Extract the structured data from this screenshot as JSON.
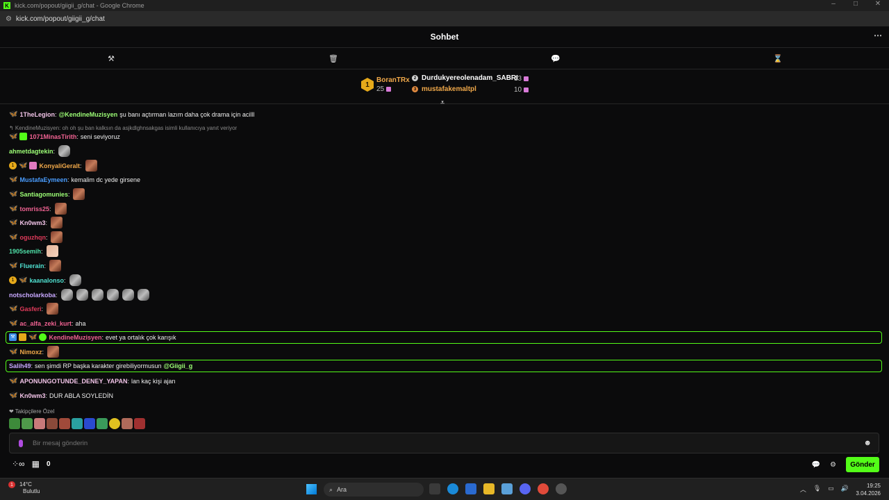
{
  "window": {
    "title": "kick.com/popout/giigii_g/chat - Google Chrome",
    "url": "kick.com/popout/giigii_g/chat",
    "controls": [
      "–",
      "□",
      "✕"
    ]
  },
  "chat": {
    "title": "Sohbet",
    "more_icon": "⋯",
    "mod_tools": [
      {
        "name": "hammer-icon",
        "glyph": "⚒"
      },
      {
        "name": "trash-icon",
        "glyph": "🗑"
      },
      {
        "name": "chat-bubble-icon",
        "glyph": "💬"
      },
      {
        "name": "hourglass-icon",
        "glyph": "⌛"
      }
    ]
  },
  "leaderboard": {
    "first": {
      "rank": "1",
      "name": "BoranTRx",
      "count": "25"
    },
    "second": {
      "rank": "2",
      "name": "Durdukyereolenadam_SABRI",
      "count": "13"
    },
    "third": {
      "rank": "3",
      "name": "mustafakemaltpl",
      "count": "10"
    }
  },
  "messages": {
    "m1": {
      "user": "1TheLegion",
      "mention": "@KendineMuzisyen",
      "text": "şu banı açtırman lazım daha çok drama için acilll"
    },
    "reply": "↰ KendineMuzisyen: oh oh şu ban kalksın da asjkdlghnsakgas isimli kullanıcıya yanıt veriyor",
    "m2": {
      "user": "1071MinasTirith",
      "text": "seni seviyoruz"
    },
    "m3": {
      "user": "ahmetdagtekin"
    },
    "m4": {
      "user": "KonyaliGeralt"
    },
    "m5": {
      "user": "MustafaEymeen",
      "text": "kemalim dc yede girsene"
    },
    "m6": {
      "user": "Santiagomunies"
    },
    "m7": {
      "user": "tomriss25"
    },
    "m8": {
      "user": "Kn0wm3"
    },
    "m9": {
      "user": "oguzhqn"
    },
    "m10": {
      "user": "1905semih"
    },
    "m11": {
      "user": "Fluerain"
    },
    "m12": {
      "user": "kaanalonso"
    },
    "m13": {
      "user": "notscholarkoba"
    },
    "m14": {
      "user": "Gasferi"
    },
    "m15": {
      "user": "ac_alfa_zeki_kurt",
      "text": "aha"
    },
    "m16": {
      "user": "KendineMuzisyen",
      "text": "evet ya ortalık çok karışık"
    },
    "m17": {
      "user": "Nimoxz"
    },
    "m18": {
      "user": "Salih49",
      "text": "sen şimdi RP başka karakter girebiliyormusun",
      "mention": "@Giigii_g"
    },
    "m19": {
      "user": "APONUNGOTUNDE_DENEY_YAPAN",
      "text": "lan kaç kişi ajan"
    },
    "m20": {
      "user": "Kn0wm3",
      "text": "DUR ABLA SOYLEDİN"
    }
  },
  "followers_only": "❤ Takipçilere Özel",
  "input": {
    "placeholder": "Bir mesaj gönderin"
  },
  "bottom": {
    "points": "0",
    "send_label": "Gönder"
  },
  "taskbar": {
    "weather_temp": "14°C",
    "weather_desc": "Bulutlu",
    "notif_count": "1",
    "search_placeholder": "Ara",
    "time": "19:25",
    "date": "3.04.2026"
  },
  "colors": {
    "accent": "#53fc18",
    "gold": "#f1a94a"
  }
}
